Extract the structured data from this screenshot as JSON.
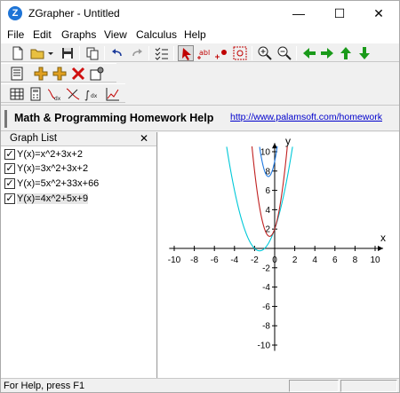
{
  "window": {
    "title": "ZGrapher - Untitled",
    "icon_letter": "Z"
  },
  "menu": [
    "File",
    "Edit",
    "Graphs",
    "View",
    "Calculus",
    "Help"
  ],
  "banner": {
    "title": "Math & Programming Homework Help",
    "link": "http://www.palamsoft.com/homework"
  },
  "graph_list": {
    "title": "Graph List",
    "items": [
      {
        "label": "Y(x)=x^2+3x+2",
        "checked": true
      },
      {
        "label": "Y(x)=3x^2+3x+2",
        "checked": true
      },
      {
        "label": "Y(x)=5x^2+33x+66",
        "checked": true
      },
      {
        "label": "Y(x)=4x^2+5x+9",
        "checked": true,
        "selected": true
      }
    ]
  },
  "chart_data": {
    "type": "line",
    "xlabel": "x",
    "ylabel": "y",
    "xlim": [
      -12,
      12
    ],
    "ylim": [
      -11,
      11
    ],
    "xticks": [
      -10,
      -8,
      -6,
      -4,
      -2,
      0,
      2,
      4,
      6,
      8,
      10
    ],
    "yticks": [
      -10,
      -8,
      -6,
      -4,
      -2,
      2,
      4,
      6,
      8,
      10
    ],
    "grid": false,
    "series": [
      {
        "expr": "x^2+3x+2",
        "a": 1,
        "b": 3,
        "c": 2,
        "color": "#00c8d8"
      },
      {
        "expr": "3x^2+3x+2",
        "a": 3,
        "b": 3,
        "c": 2,
        "color": "#c02020"
      },
      {
        "expr": "5x^2+33x+66",
        "a": 5,
        "b": 33,
        "c": 66,
        "color": "#1a1a8a"
      },
      {
        "expr": "4x^2+5x+9",
        "a": 4,
        "b": 5,
        "c": 9,
        "color": "#1e78e0"
      }
    ]
  },
  "status": {
    "text": "For Help, press F1"
  }
}
